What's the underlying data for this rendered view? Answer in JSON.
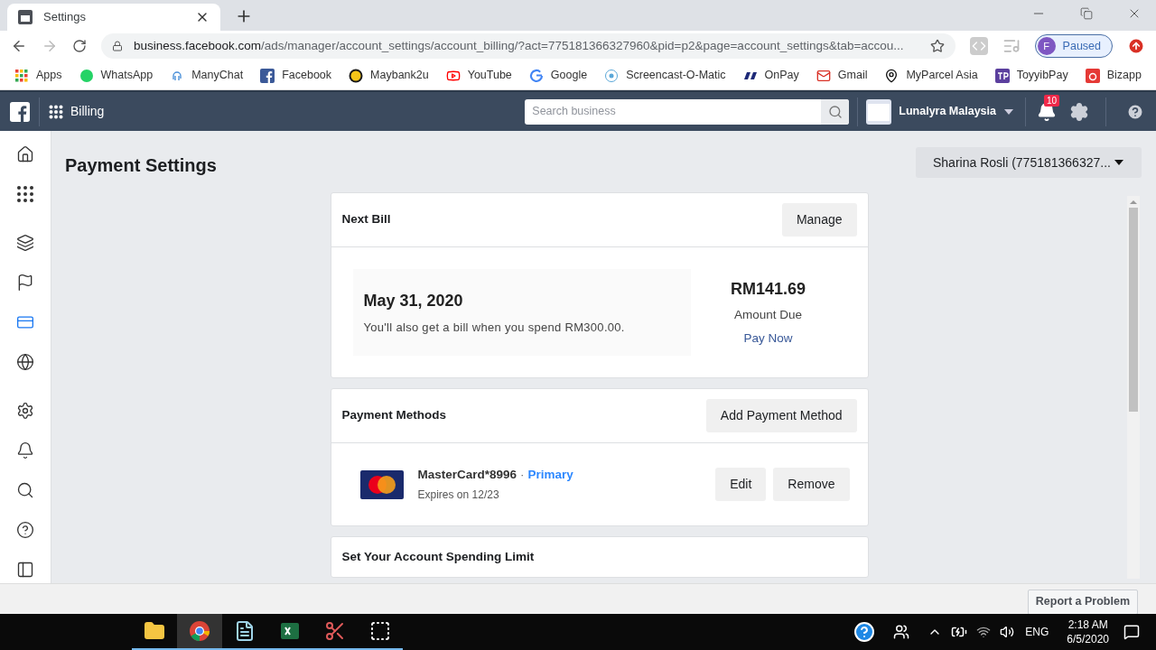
{
  "browser": {
    "tab_title": "Settings",
    "url_host": "business.facebook.com",
    "url_path": "/ads/manager/account_settings/account_billing/?act=775181366327960&pid=p2&page=account_settings&tab=accou...",
    "profile_initial": "F",
    "profile_status": "Paused",
    "bookmarks": [
      {
        "label": "Apps",
        "kind": "apps"
      },
      {
        "label": "WhatsApp",
        "kind": "whatsapp"
      },
      {
        "label": "ManyChat",
        "kind": "manychat"
      },
      {
        "label": "Facebook",
        "kind": "facebook"
      },
      {
        "label": "Maybank2u",
        "kind": "maybank"
      },
      {
        "label": "YouTube",
        "kind": "youtube"
      },
      {
        "label": "Google",
        "kind": "google"
      },
      {
        "label": "Screencast-O-Matic",
        "kind": "screencast"
      },
      {
        "label": "OnPay",
        "kind": "onpay"
      },
      {
        "label": "Gmail",
        "kind": "gmail"
      },
      {
        "label": "MyParcel Asia",
        "kind": "pin"
      },
      {
        "label": "ToyyibPay",
        "kind": "toyyib"
      },
      {
        "label": "Bizapp",
        "kind": "bizapp"
      }
    ]
  },
  "header": {
    "section": "Billing",
    "search_placeholder": "Search business",
    "business_name": "Lunalyra Malaysia",
    "notification_count": "10"
  },
  "sidebar": {
    "items": [
      {
        "kind": "home",
        "selected": false
      },
      {
        "kind": "grid",
        "selected": false
      },
      {
        "kind": "pages",
        "selected": false
      },
      {
        "kind": "flag",
        "selected": false
      },
      {
        "kind": "card",
        "selected": true
      },
      {
        "kind": "globe",
        "selected": false
      },
      {
        "kind": "settings",
        "selected": false
      },
      {
        "kind": "bell",
        "selected": false
      },
      {
        "kind": "search",
        "selected": false
      },
      {
        "kind": "help",
        "selected": false
      },
      {
        "kind": "panel",
        "selected": false
      }
    ]
  },
  "page": {
    "title": "Payment Settings",
    "account_selector": "Sharina Rosli (775181366327...",
    "next_bill": {
      "title": "Next Bill",
      "action": "Manage",
      "date": "May 31, 2020",
      "note": "You'll also get a bill when you spend RM300.00.",
      "amount": "RM141.69",
      "amount_label": "Amount Due",
      "pay_link": "Pay Now"
    },
    "payment_methods": {
      "title": "Payment Methods",
      "action": "Add Payment Method",
      "cards": [
        {
          "name": "MasterCard*8996",
          "separator": "·",
          "badge": "Primary",
          "expiry": "Expires on 12/23",
          "buttons": [
            "Edit",
            "Remove"
          ]
        }
      ]
    },
    "spending_limit": {
      "title": "Set Your Account Spending Limit"
    },
    "report_button": "Report a Problem"
  },
  "taskbar": {
    "apps": [
      {
        "kind": "explorer",
        "selected": false
      },
      {
        "kind": "chrome",
        "selected": true
      },
      {
        "kind": "notepad",
        "selected": false
      },
      {
        "kind": "excel",
        "selected": false
      },
      {
        "kind": "snip",
        "selected": false
      },
      {
        "kind": "select",
        "selected": false
      }
    ],
    "language": "ENG",
    "time": "2:18 AM",
    "date": "6/5/2020"
  }
}
